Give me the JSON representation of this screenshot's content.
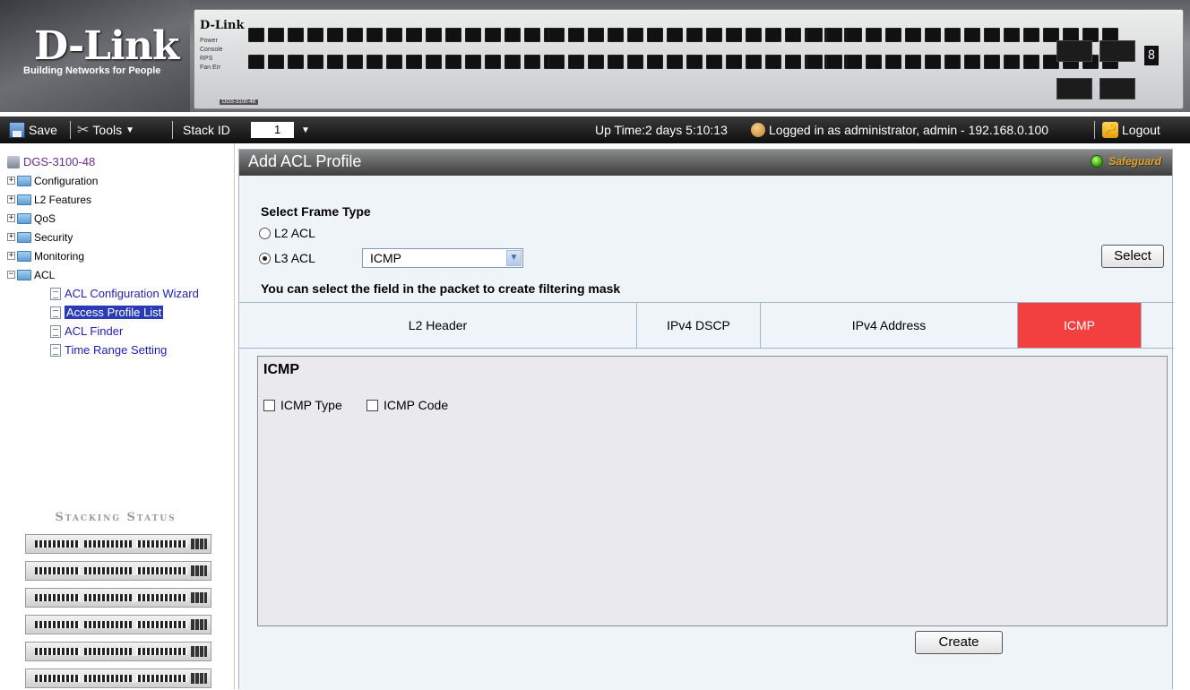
{
  "brand": {
    "logo": "D-Link",
    "tagline": "Building Networks for People",
    "switch_brand": "D-Link",
    "switch_model": "DGS-3100-48",
    "switch_leds": [
      "Power",
      "Console",
      "RPS",
      "Fan Err"
    ],
    "unit_digit": "8"
  },
  "toolbar": {
    "save_label": "Save",
    "tools_label": "Tools",
    "stack_id_label": "Stack ID",
    "stack_id_value": "1",
    "status_text": "Up Time:2 days 5:10:13",
    "login_text": "Logged in as administrator, admin - 192.168.0.100",
    "logout_label": "Logout"
  },
  "tree": {
    "root": "DGS-3100-48",
    "folders": [
      "Configuration",
      "L2 Features",
      "QoS",
      "Security",
      "Monitoring",
      "ACL"
    ],
    "acl_items": [
      "ACL Configuration Wizard",
      "Access Profile List",
      "ACL Finder",
      "Time Range Setting"
    ],
    "selected_index": 1
  },
  "stacking": {
    "title": "Stacking Status",
    "units": 6
  },
  "main": {
    "title": "Add ACL Profile",
    "safeguard_label": "Safeguard",
    "frame_type_label": "Select Frame Type",
    "radio_l2": "L2 ACL",
    "radio_l3": "L3 ACL",
    "l3_selected": "ICMP",
    "select_button": "Select",
    "mask_hint": "You can select the field in the packet to create filtering mask",
    "tabs": [
      "L2 Header",
      "IPv4 DSCP",
      "IPv4 Address",
      "ICMP"
    ],
    "active_tab": "ICMP",
    "section_title": "ICMP",
    "checkbox_type": "ICMP Type",
    "checkbox_code": "ICMP Code",
    "create_button": "Create"
  },
  "colors": {
    "active_tab": "#f24040",
    "selected_tree_item": "#2a3bb8",
    "panel_bg": "#eef4f7",
    "safeguard": "#e3a42a"
  }
}
